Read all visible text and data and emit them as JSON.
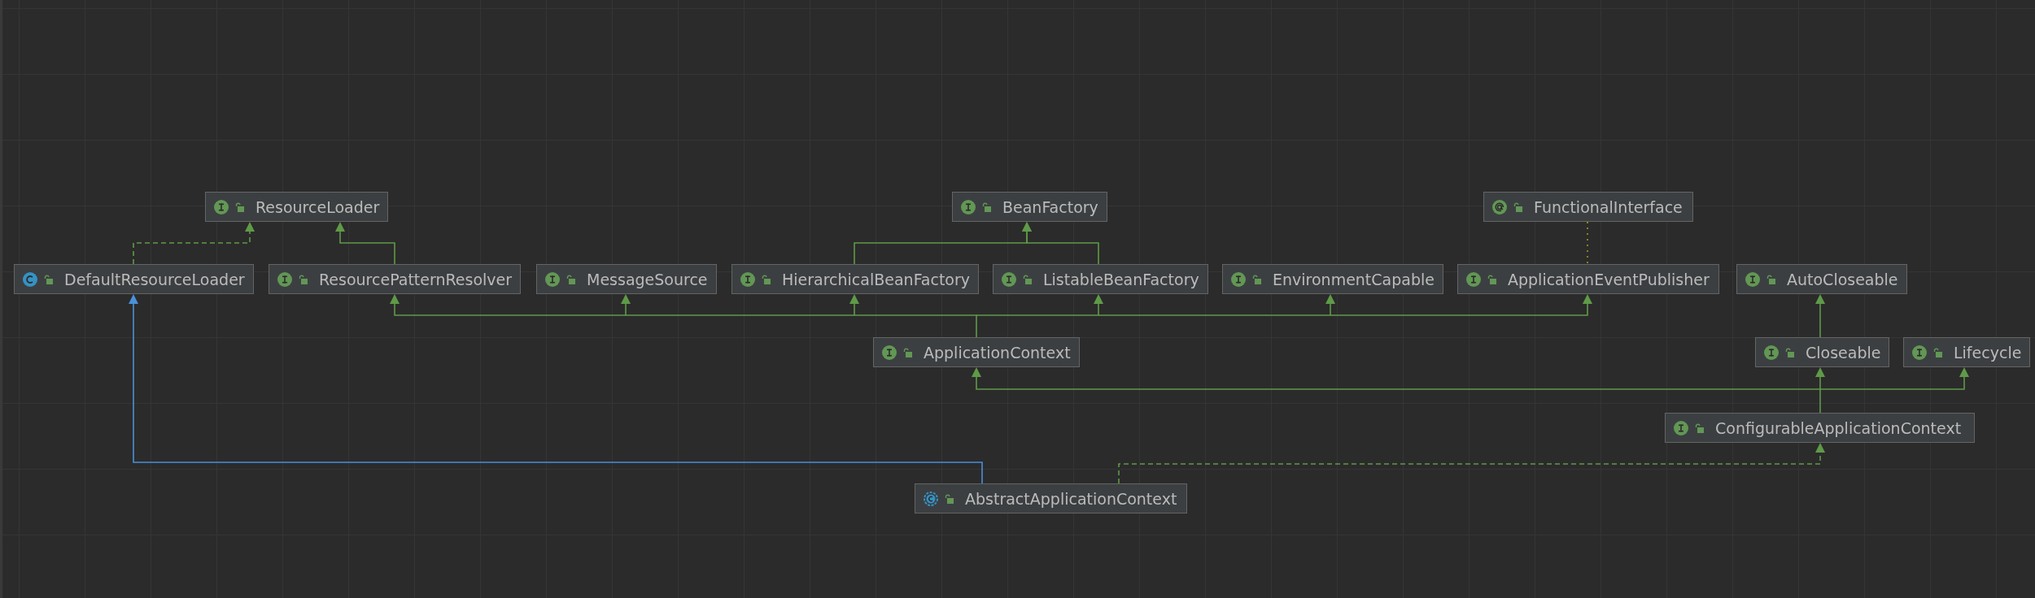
{
  "diagram": {
    "nodes": [
      {
        "name": "ResourceLoader",
        "kind": "interface"
      },
      {
        "name": "BeanFactory",
        "kind": "interface"
      },
      {
        "name": "FunctionalInterface",
        "kind": "annotation"
      },
      {
        "name": "DefaultResourceLoader",
        "kind": "class"
      },
      {
        "name": "ResourcePatternResolver",
        "kind": "interface"
      },
      {
        "name": "MessageSource",
        "kind": "interface"
      },
      {
        "name": "HierarchicalBeanFactory",
        "kind": "interface"
      },
      {
        "name": "ListableBeanFactory",
        "kind": "interface"
      },
      {
        "name": "EnvironmentCapable",
        "kind": "interface"
      },
      {
        "name": "ApplicationEventPublisher",
        "kind": "interface"
      },
      {
        "name": "AutoCloseable",
        "kind": "interface"
      },
      {
        "name": "ApplicationContext",
        "kind": "interface"
      },
      {
        "name": "Closeable",
        "kind": "interface"
      },
      {
        "name": "Lifecycle",
        "kind": "interface"
      },
      {
        "name": "ConfigurableApplicationContext",
        "kind": "interface"
      },
      {
        "name": "AbstractApplicationContext",
        "kind": "abstract_class"
      }
    ]
  }
}
